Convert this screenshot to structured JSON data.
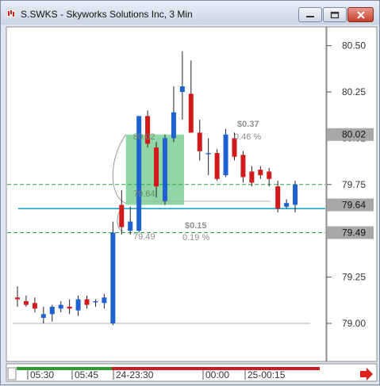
{
  "window": {
    "title": "S.SWKS - Skyworks Solutions Inc, 3 Min"
  },
  "colors": {
    "up": "#1e62d0",
    "down": "#d11a1a",
    "sma_teal": "#1ca5c4",
    "green_dashed": "#22aa44",
    "gray_ref": "#b0b0b0",
    "box_fill": "#7ccf96",
    "timeline_green": "#2f9c2f",
    "timeline_red": "#c82020",
    "price_box": "#a8a8a8",
    "arrow": "#e02020"
  },
  "chart_data": {
    "type": "candlestick",
    "symbol": "S.SWKS",
    "interval": "3 Min",
    "ylim": [
      78.82,
      80.58
    ],
    "y_ticks": [
      79.0,
      79.25,
      79.5,
      79.75,
      80.0,
      80.25,
      80.5
    ],
    "y_tick_labels": [
      "79.00",
      "79.25",
      "79.49",
      "79.75",
      "80.02",
      "80.25",
      "80.50"
    ],
    "price_boxes": [
      "80.02",
      "79.64",
      "79.49"
    ],
    "x_labels": [
      "05:30",
      "05:45",
      "24-23:30",
      "00:00",
      "25-00:15"
    ],
    "candles": [
      {
        "x": 0,
        "o": 79.14,
        "h": 79.2,
        "l": 79.09,
        "c": 79.13
      },
      {
        "x": 1,
        "o": 79.12,
        "h": 79.15,
        "l": 79.09,
        "c": 79.1
      },
      {
        "x": 2,
        "o": 79.11,
        "h": 79.14,
        "l": 79.06,
        "c": 79.08
      },
      {
        "x": 3,
        "o": 79.03,
        "h": 79.09,
        "l": 79.0,
        "c": 79.05
      },
      {
        "x": 4,
        "o": 79.05,
        "h": 79.1,
        "l": 79.01,
        "c": 79.09
      },
      {
        "x": 5,
        "o": 79.08,
        "h": 79.12,
        "l": 79.06,
        "c": 79.1
      },
      {
        "x": 6,
        "o": 79.09,
        "h": 79.13,
        "l": 79.05,
        "c": 79.08
      },
      {
        "x": 7,
        "o": 79.07,
        "h": 79.15,
        "l": 79.04,
        "c": 79.13
      },
      {
        "x": 8,
        "o": 79.13,
        "h": 79.15,
        "l": 79.08,
        "c": 79.1
      },
      {
        "x": 9,
        "o": 79.12,
        "h": 79.13,
        "l": 79.09,
        "c": 79.12
      },
      {
        "x": 10,
        "o": 79.11,
        "h": 79.16,
        "l": 79.08,
        "c": 79.14
      },
      {
        "x": 11,
        "o": 79.0,
        "h": 79.55,
        "l": 78.99,
        "c": 79.49
      },
      {
        "x": 12,
        "o": 79.64,
        "h": 79.72,
        "l": 79.48,
        "c": 79.52
      },
      {
        "x": 13,
        "o": 79.5,
        "h": 79.63,
        "l": 79.48,
        "c": 79.55
      },
      {
        "x": 14,
        "o": 79.5,
        "h": 80.12,
        "l": 79.49,
        "c": 80.12
      },
      {
        "x": 15,
        "o": 80.12,
        "h": 80.15,
        "l": 79.95,
        "c": 79.97
      },
      {
        "x": 16,
        "o": 79.95,
        "h": 79.98,
        "l": 79.68,
        "c": 79.74
      },
      {
        "x": 17,
        "o": 79.66,
        "h": 80.02,
        "l": 79.64,
        "c": 80.0
      },
      {
        "x": 18,
        "o": 80.0,
        "h": 80.28,
        "l": 79.98,
        "c": 80.14
      },
      {
        "x": 19,
        "o": 80.25,
        "h": 80.47,
        "l": 80.1,
        "c": 80.28
      },
      {
        "x": 20,
        "o": 80.24,
        "h": 80.42,
        "l": 80.05,
        "c": 80.03
      },
      {
        "x": 21,
        "o": 80.03,
        "h": 80.1,
        "l": 79.88,
        "c": 79.93
      },
      {
        "x": 22,
        "o": 79.92,
        "h": 80.0,
        "l": 79.8,
        "c": 79.92
      },
      {
        "x": 23,
        "o": 79.92,
        "h": 79.94,
        "l": 79.77,
        "c": 79.78
      },
      {
        "x": 24,
        "o": 79.8,
        "h": 80.05,
        "l": 79.79,
        "c": 80.02
      },
      {
        "x": 25,
        "o": 80.0,
        "h": 80.03,
        "l": 79.88,
        "c": 79.9
      },
      {
        "x": 26,
        "o": 79.91,
        "h": 79.93,
        "l": 79.76,
        "c": 79.79
      },
      {
        "x": 27,
        "o": 79.82,
        "h": 79.85,
        "l": 79.74,
        "c": 79.76
      },
      {
        "x": 28,
        "o": 79.83,
        "h": 79.85,
        "l": 79.78,
        "c": 79.8
      },
      {
        "x": 29,
        "o": 79.82,
        "h": 79.84,
        "l": 79.74,
        "c": 79.78
      },
      {
        "x": 30,
        "o": 79.74,
        "h": 79.77,
        "l": 79.6,
        "c": 79.62
      },
      {
        "x": 31,
        "o": 79.63,
        "h": 79.67,
        "l": 79.62,
        "c": 79.65
      },
      {
        "x": 32,
        "o": 79.64,
        "h": 79.77,
        "l": 79.6,
        "c": 79.75
      }
    ],
    "lines": {
      "sma": 79.62,
      "green_upper": 79.75,
      "green_lower": 79.49,
      "gray_bottom": 79.0
    },
    "box": {
      "x_start": 12.5,
      "x_end": 19.2,
      "y_low": 79.64,
      "y_high": 80.02
    },
    "annotations": [
      {
        "name": "box-top-price",
        "text": "80.02"
      },
      {
        "name": "box-bottom-price",
        "text": "79.64"
      },
      {
        "name": "upper-change",
        "text": "$0.37"
      },
      {
        "name": "upper-percent",
        "text": "0.46 %"
      },
      {
        "name": "lower-change",
        "text": "$0.15"
      },
      {
        "name": "lower-percent",
        "text": "0.19 %"
      },
      {
        "name": "lower-price",
        "text": "79.49"
      }
    ]
  }
}
